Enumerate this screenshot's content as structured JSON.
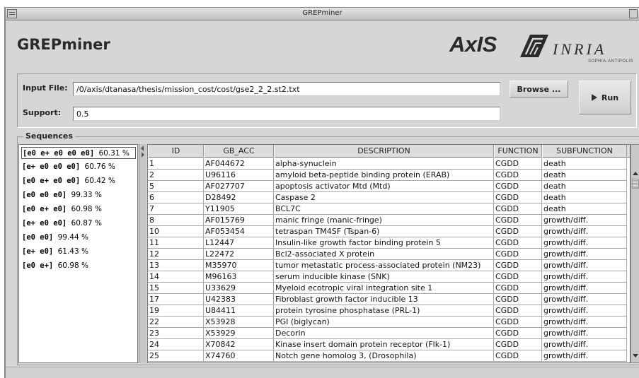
{
  "window": {
    "title": "GREPminer"
  },
  "app": {
    "title": "GREPminer"
  },
  "logo": {
    "axis": "AxIS",
    "inria": "INRIA",
    "sophia": "SOPHIA-ANTIPOLIS"
  },
  "input": {
    "file_label": "Input File:",
    "file_value": "/0/axis/dtanasa/thesis/mission_cost/cost/gse2_2_2.st2.txt",
    "support_label": "Support:",
    "support_value": "0.5",
    "browse_label": "Browse ...",
    "run_label": "Run"
  },
  "sequences": {
    "title": "Sequences",
    "items": [
      {
        "seq": "[e0 e+ e0 e0 e0]",
        "pct": "60.31 %",
        "selected": true
      },
      {
        "seq": "[e+ e0 e0 e0]",
        "pct": "60.76 %"
      },
      {
        "seq": "[e0 e+ e0 e0]",
        "pct": "60.42 %"
      },
      {
        "seq": "[e0 e0 e0]",
        "pct": "99.33 %"
      },
      {
        "seq": "[e0 e+ e0]",
        "pct": "60.98 %"
      },
      {
        "seq": "[e+ e0 e0]",
        "pct": "60.87 %"
      },
      {
        "seq": "[e0 e0]",
        "pct": "99.44 %"
      },
      {
        "seq": "[e+ e0]",
        "pct": "61.43 %"
      },
      {
        "seq": "[e0 e+]",
        "pct": "60.98 %"
      }
    ]
  },
  "table": {
    "columns": [
      "ID",
      "GB_ACC",
      "DESCRIPTION",
      "FUNCTION",
      "SUBFUNCTION"
    ],
    "rows": [
      [
        "1",
        "AF044672",
        "alpha-synuclein",
        "CGDD",
        "death"
      ],
      [
        "2",
        "U96116",
        "amyloid beta-peptide binding protein (ERAB)",
        "CGDD",
        "death"
      ],
      [
        "5",
        "AF027707",
        "apoptosis activator Mtd (Mtd)",
        "CGDD",
        "death"
      ],
      [
        "6",
        "D28492",
        "Caspase 2",
        "CGDD",
        "death"
      ],
      [
        "7",
        "Y11905",
        "BCL7C",
        "CGDD",
        "death"
      ],
      [
        "8",
        "AF015769",
        "manic fringe (manic-fringe)",
        "CGDD",
        "growth/diff."
      ],
      [
        "10",
        "AF053454",
        "tetraspan TM4SF (Tspan-6)",
        "CGDD",
        "growth/diff."
      ],
      [
        "11",
        "L12447",
        "Insulin-like growth factor binding protein 5",
        "CGDD",
        "growth/diff."
      ],
      [
        "12",
        "L22472",
        "Bcl2-associated X protein",
        "CGDD",
        "growth/diff."
      ],
      [
        "13",
        "M35970",
        "tumor metastatic process-associated protein (NM23)",
        "CGDD",
        "growth/diff."
      ],
      [
        "14",
        "M96163",
        "serum inducible kinase (SNK)",
        "CGDD",
        "growth/diff."
      ],
      [
        "15",
        "U33629",
        "Myeloid ecotropic viral integration site 1",
        "CGDD",
        "growth/diff."
      ],
      [
        "17",
        "U42383",
        "Fibroblast growth factor inducible 13",
        "CGDD",
        "growth/diff."
      ],
      [
        "19",
        "U84411",
        "protein tyrosine phosphatase (PRL-1)",
        "CGDD",
        "growth/diff."
      ],
      [
        "22",
        "X53928",
        "PGI (biglycan)",
        "CGDD",
        "growth/diff."
      ],
      [
        "23",
        "X53929",
        "Decorin",
        "CGDD",
        "growth/diff."
      ],
      [
        "24",
        "X70842",
        "Kinase insert domain protein receptor (Flk-1)",
        "CGDD",
        "growth/diff."
      ],
      [
        "25",
        "X74760",
        "Notch gene homolog 3, (Drosophila)",
        "CGDD",
        "growth/diff."
      ]
    ]
  }
}
